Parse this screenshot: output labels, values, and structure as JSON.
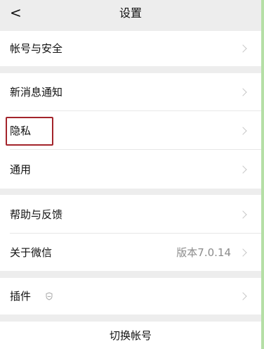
{
  "nav": {
    "back": "<",
    "title": "设置"
  },
  "groups": {
    "account_security": "帐号与安全",
    "new_message_notification": "新消息通知",
    "privacy": "隐私",
    "general": "通用",
    "help_feedback": "帮助与反馈",
    "about_wechat": "关于微信",
    "about_version": "版本7.0.14",
    "plugins": "插件",
    "switch_account": "切换帐号"
  },
  "colors": {
    "background": "#ededed",
    "row": "#ffffff",
    "highlight": "#a3242b",
    "chevron": "#c6c6c6",
    "edge": "#b5dfa6"
  },
  "icons": {
    "back": "chevron-left-icon",
    "plugin": "plugin-shield-icon",
    "row_chevron": "chevron-right-icon"
  }
}
